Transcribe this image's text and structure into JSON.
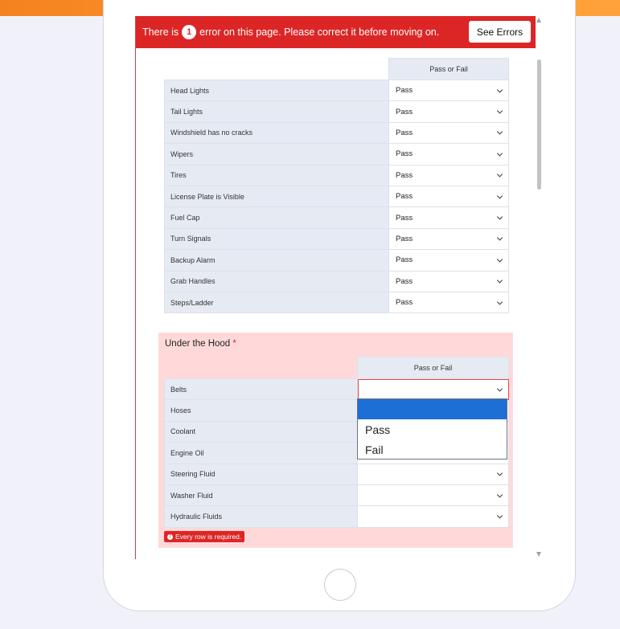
{
  "error_banner": {
    "text_before": "There is",
    "error_count": "1",
    "text_after": "error on this page. Please correct it before moving on.",
    "see_errors_label": "See Errors"
  },
  "exterior_table": {
    "column_header": "Pass or Fail",
    "rows": [
      {
        "label": "Head Lights",
        "value": "Pass"
      },
      {
        "label": "Tail Lights",
        "value": "Pass"
      },
      {
        "label": "Windshield has no cracks",
        "value": "Pass"
      },
      {
        "label": "Wipers",
        "value": "Pass"
      },
      {
        "label": "Tires",
        "value": "Pass"
      },
      {
        "label": "License Plate is Visible",
        "value": "Pass"
      },
      {
        "label": "Fuel Cap",
        "value": "Pass"
      },
      {
        "label": "Turn Signals",
        "value": "Pass"
      },
      {
        "label": "Backup Alarm",
        "value": "Pass"
      },
      {
        "label": "Grab Handles",
        "value": "Pass"
      },
      {
        "label": "Steps/Ladder",
        "value": "Pass"
      }
    ]
  },
  "under_the_hood": {
    "title": "Under the Hood",
    "required_mark": "*",
    "column_header": "Pass or Fail",
    "rows": [
      {
        "label": "Belts",
        "value": ""
      },
      {
        "label": "Hoses",
        "value": ""
      },
      {
        "label": "Coolant",
        "value": ""
      },
      {
        "label": "Engine Oil",
        "value": ""
      },
      {
        "label": "Steering Fluid",
        "value": ""
      },
      {
        "label": "Washer Fluid",
        "value": ""
      },
      {
        "label": "Hydraulic Fluids",
        "value": ""
      }
    ],
    "error_message": "Every row is required.",
    "error_icon": "!"
  },
  "dropdown": {
    "options": [
      "",
      "Pass",
      "Fail"
    ]
  },
  "colors": {
    "error_red": "#dc2626",
    "accent_orange": "#f58220",
    "selected_blue": "#1d6fd6"
  }
}
